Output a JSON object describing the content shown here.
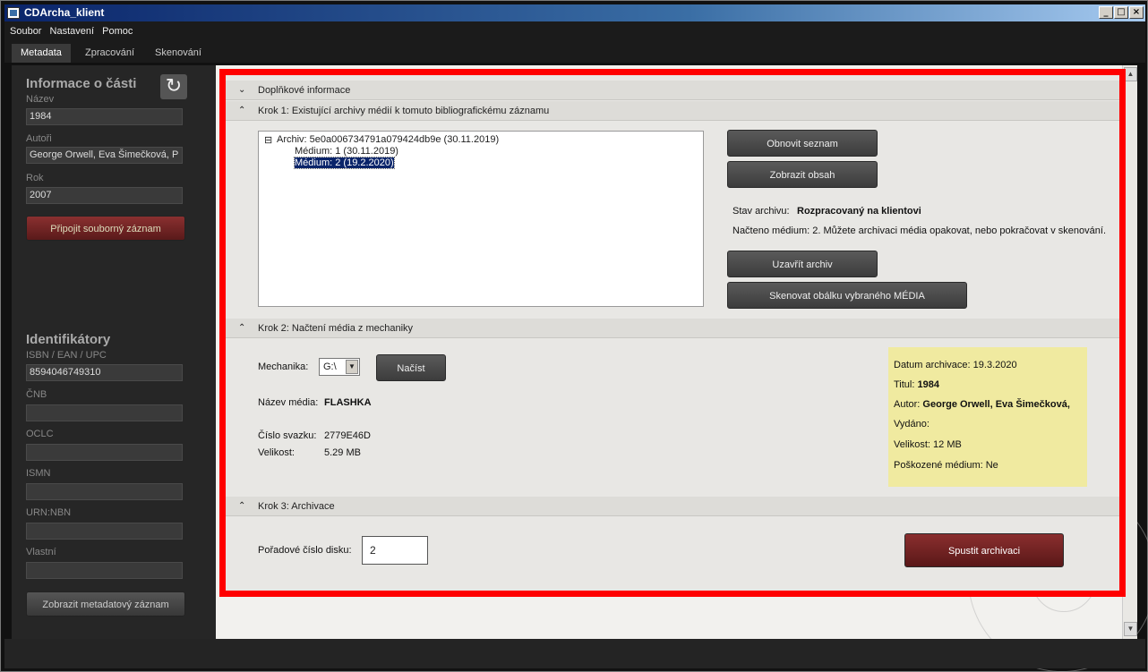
{
  "window": {
    "title": "CDArcha_klient",
    "controls": [
      "_",
      "□",
      "×"
    ]
  },
  "menu": [
    "Soubor",
    "Nastavení",
    "Pomoc"
  ],
  "tabs": [
    "Metadata",
    "Zpracování",
    "Skenování"
  ],
  "sidebar": {
    "part_title": "Informace o části",
    "name_label": "Název",
    "name_value": "1984",
    "authors_label": "Autoři",
    "authors_value": "George Orwell,  Eva Šimečková,  P",
    "year_label": "Rok",
    "year_value": "2007",
    "attach_button": "Připojit souborný záznam",
    "identifiers_title": "Identifikátory",
    "isbn_label": "ISBN / EAN / UPC",
    "isbn_value": "8594046749310",
    "cnb_label": "ČNB",
    "oclc_label": "OCLC",
    "ismn_label": "ISMN",
    "urn_label": "URN:NBN",
    "own_label": "Vlastní",
    "show_metadata_button": "Zobrazit metadatový záznam"
  },
  "sections": {
    "extra": "Doplňkové informace",
    "step1": "Krok 1: Existující archivy médií k tomuto bibliografickému záznamu",
    "step2": "Krok 2: Načtení média z mechaniky",
    "step3": "Krok 3: Archivace"
  },
  "tree": {
    "toggle": "⊟",
    "archive": "Archiv:   5e0a006734791a079424db9e   (30.11.2019)",
    "medium1": "Médium:  1  (30.11.2019)",
    "medium2": "Médium:  2  (19.2.2020)"
  },
  "step1": {
    "refresh_button": "Obnovit seznam",
    "show_content_button": "Zobrazit obsah",
    "state_label": "Stav archivu:",
    "state_value": "Rozpracovaný na klientovi",
    "loaded_text": "Načteno médium: 2. Můžete archivaci média opakovat, nebo pokračovat v skenování.",
    "close_button": "Uzavřít archiv",
    "scan_button": "Skenovat obálku vybraného MÉDIA"
  },
  "step2": {
    "drive_label": "Mechanika:",
    "drive_value": "G:\\",
    "load_button": "Načíst",
    "media_name_label": "Název média:",
    "media_name_value": "FLASHKA",
    "volume_label": "Číslo svazku:",
    "volume_value": "2779E46D",
    "size_label": "Velikost:",
    "size_value": "5.29 MB"
  },
  "info_box": {
    "date_label": "Datum archivace:",
    "date_value": "19.3.2020",
    "title_label": "Titul:",
    "title_value": "1984",
    "author_label": "Autor:",
    "author_value": "George Orwell,  Eva Šimečková,",
    "issued_label": "Vydáno:",
    "size_label": "Velikost:",
    "size_value": "12 MB",
    "damaged_label": "Poškozené médium:",
    "damaged_value": "Ne"
  },
  "step3": {
    "disk_label": "Pořadové číslo disku:",
    "disk_value": "2",
    "start_button": "Spustit archivaci"
  },
  "colors": {
    "highlight_frame": "#ff0000",
    "info_box": "#f0eaa0",
    "primary_button": "#6b2222"
  }
}
